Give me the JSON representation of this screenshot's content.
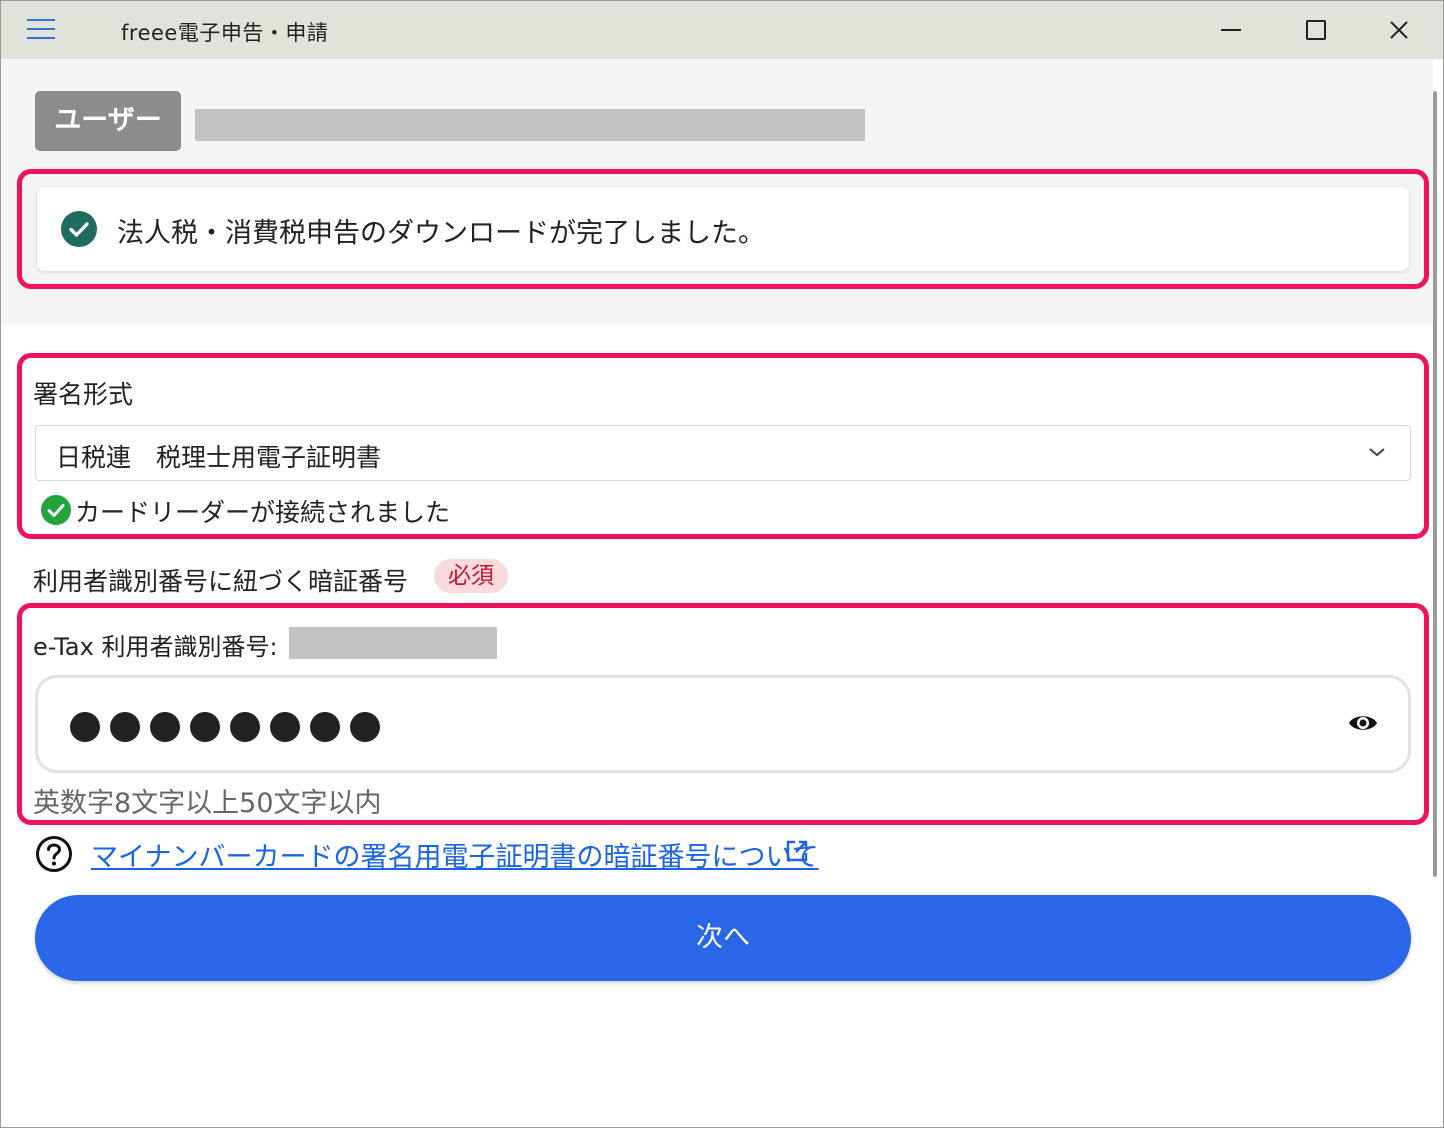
{
  "window": {
    "title": "freee電子申告・申請"
  },
  "user": {
    "label": "ユーザー"
  },
  "notice": {
    "message": "法人税・消費税申告のダウンロードが完了しました。",
    "icon": "check-circle-icon",
    "icon_color": "#1f6b5d"
  },
  "signature": {
    "label": "署名形式",
    "selected": "日税連　税理士用電子証明書",
    "status": "カードリーダーが接続されました",
    "status_color": "#22a43b"
  },
  "pin": {
    "label": "利用者識別番号に紐づく暗証番号",
    "required": "必須",
    "etax_label": "e-Tax 利用者識別番号:",
    "masked_length": 8,
    "hint": "英数字8文字以上50文字以内"
  },
  "help": {
    "link_text": "マイナンバーカードの署名用電子証明書の暗証番号について"
  },
  "actions": {
    "next": "次へ"
  },
  "colors": {
    "accent": "#2a66e8",
    "highlight_border": "#f0115f",
    "link": "#1a64e6"
  }
}
